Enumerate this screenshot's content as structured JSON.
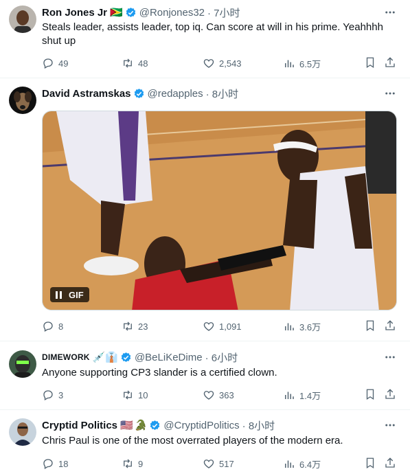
{
  "tweets": [
    {
      "author_name": "Ron Jones Jr",
      "author_flag": "🇬🇾",
      "handle": "@Ronjones32",
      "time": "· 7小时",
      "text": "Steals leader, assists leader, top iq. Can score at will in his prime. Yeahhhh shut up",
      "replies": "49",
      "retweets": "48",
      "likes": "2,543",
      "views": "6.5万"
    },
    {
      "author_name": "David Astramskas",
      "handle": "@redapples",
      "time": "· 8小时",
      "media_badge": "GIF",
      "replies": "8",
      "retweets": "23",
      "likes": "1,091",
      "views": "3.6万"
    },
    {
      "author_name": "DIMEWORK",
      "author_emoji": "💉👔",
      "handle": "@BeLiKeDime",
      "time": "· 6小时",
      "text": "Anyone supporting CP3 slander is a certified clown.",
      "replies": "3",
      "retweets": "10",
      "likes": "363",
      "views": "1.4万"
    },
    {
      "author_name": "Cryptid Politics",
      "author_flag": "🇺🇸",
      "author_emoji": "🐊",
      "handle": "@CryptidPolitics",
      "time": "· 8小时",
      "text": "Chris Paul is one of the most overrated players of the modern era.",
      "replies": "18",
      "retweets": "9",
      "likes": "517",
      "views": "6.4万"
    }
  ],
  "colors": {
    "verified": "#1d9bf0",
    "secondary_text": "#536471",
    "primary_text": "#0f1419",
    "divider": "#eff3f4"
  },
  "icons": [
    "reply-icon",
    "retweet-icon",
    "like-icon",
    "views-icon",
    "bookmark-icon",
    "share-icon",
    "more-icon",
    "verified-badge-icon",
    "pause-icon"
  ]
}
